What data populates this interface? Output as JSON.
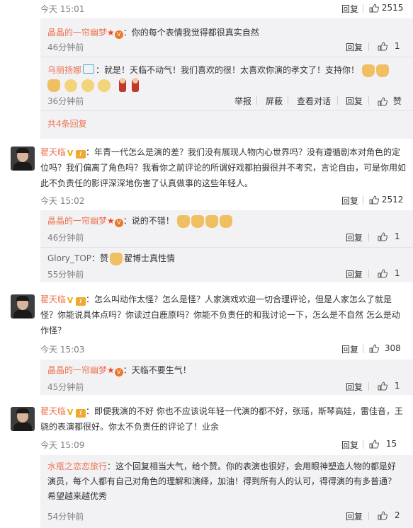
{
  "colors": {
    "username": "#eb7350",
    "reply_bg": "#f2f2f5",
    "meta": "#808080"
  },
  "top": {
    "time": "今天 15:01",
    "reply": "回复",
    "likes": "2515"
  },
  "thread1": {
    "replies": [
      {
        "user": "晶晶的一帘幽梦",
        "text": "：你的每个表情我觉得都很真实自然",
        "time": "46分钟前",
        "reply": "回复",
        "likes": "1"
      },
      {
        "user": "乌丽扬娜",
        "text": "：就是！天临不动气！我们喜欢的很！太喜欢你演的孝文了！支持你！",
        "time": "36分钟前",
        "actions": [
          "举报",
          "屏蔽",
          "查看对话",
          "回复",
          "赞"
        ]
      }
    ],
    "more": "共4条回复"
  },
  "comment2": {
    "user": "翟天临",
    "lines": [
      "：年青一代怎么是演的差？我们没有展现人物内心世界吗？没有遵循剧本对角色的定",
      "位吗？我们偏离了角色吗？我看你之前评论的所谓好戏都拍摄很并不考究，言论自由，可是你用如",
      "此不负责任的影评深深地伤害了认真做事的这些年轻人。"
    ],
    "time": "今天 15:02",
    "reply": "回复",
    "likes": "2512",
    "replies": [
      {
        "user": "晶晶的一帘幽梦",
        "text": "：说的不错！",
        "time": "46分钟前",
        "reply": "回复",
        "likes": "1"
      },
      {
        "user": "Glory_TOP",
        "text": "：赞",
        "text2": "翟博士真性情",
        "time": "55分钟前",
        "reply": "回复",
        "likes": "1"
      }
    ]
  },
  "comment3": {
    "user": "翟天临",
    "lines": [
      "：怎么叫动作太怪？怎么是怪？人家演戏欢迎一切合理评论，但是人家怎么了就是",
      "怪？你能说具体点吗？你读过白鹿原吗？你能不负责任的和我讨论一下，怎么是不自然 怎么是动",
      "作怪？"
    ],
    "time": "今天 15:03",
    "reply": "回复",
    "likes": "308",
    "replies": [
      {
        "user": "晶晶的一帘幽梦",
        "text": "：天临不要生气！",
        "time": "45分钟前",
        "reply": "回复",
        "likes": "1"
      }
    ]
  },
  "comment4": {
    "user": "翟天临",
    "lines": [
      "：即便我演的不好 你也不应该说年轻一代演的都不好，张瑶，斯琴高娃，雷佳音，王",
      "骁的表演都很好。你太不负责任的评论了！业余"
    ],
    "time": "今天 15:09",
    "reply": "回复",
    "likes": "15",
    "replies": [
      {
        "user": "水瓶之恋恋旅行",
        "lines": [
          "：这个回复相当大气，给个赞。你的表演也很好，会用眼神塑造人物的都是好",
          "演员，每个人都有自己对角色的理解和演绎，加油！得到所有人的认可，得得演的有多普通？",
          "希望越来越优秀"
        ],
        "time": "54分钟前",
        "reply": "回复",
        "likes": "2"
      }
    ]
  }
}
